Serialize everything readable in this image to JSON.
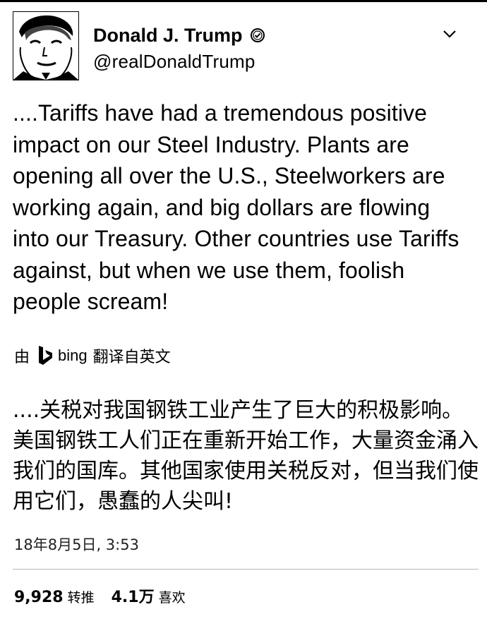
{
  "tweet": {
    "author": {
      "display_name": "Donald J. Trump",
      "handle": "@realDonaldTrump"
    },
    "text": "....Tariffs have had a tremendous positive impact on our Steel Industry. Plants are opening all over the U.S., Steelworkers are working again, and big dollars are flowing into our Treasury. Other countries use Tariffs against, but when we use them, foolish people scream!",
    "translation": {
      "prefix": "由",
      "provider": "bing",
      "suffix": "翻译自英文",
      "text": "....关税对我国钢铁工业产生了巨大的积极影响。美国钢铁工人们正在重新开始工作，大量资金涌入我们的国库。其他国家使用关税反对，但当我们使用它们，愚蠢的人尖叫!"
    },
    "timestamp": "18年8月5日, 3:53",
    "stats": {
      "retweets_count": "9,928",
      "retweets_label": "转推",
      "likes_count": "4.1万",
      "likes_label": "喜欢"
    }
  },
  "icons": {
    "verified": "verified-badge-icon",
    "caret": "chevron-down-icon",
    "bing": "bing-logo-icon"
  }
}
